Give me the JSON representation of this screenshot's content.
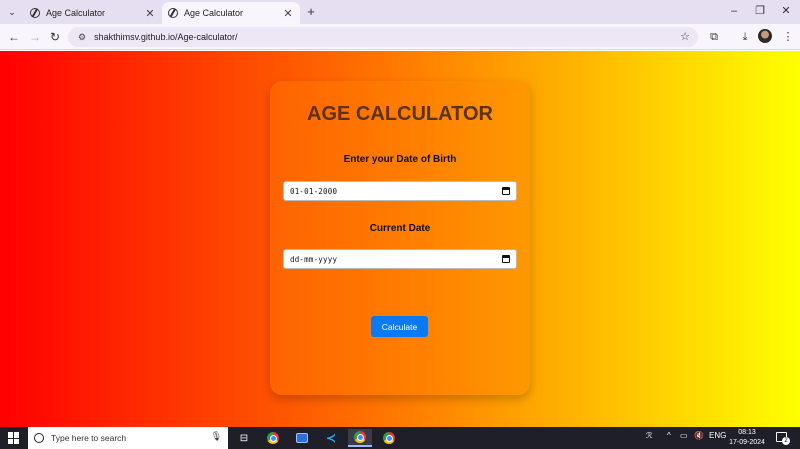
{
  "browser": {
    "tabs": [
      {
        "title": "Age Calculator",
        "active": false
      },
      {
        "title": "Age Calculator",
        "active": true
      }
    ],
    "new_tab": "+",
    "window_controls": {
      "minimize": "–",
      "restore": "❐",
      "close": "✕"
    },
    "url": "shakthimsv.github.io/Age-calculator/"
  },
  "page": {
    "title": "AGE CALCULATOR",
    "dob_label": "Enter your Date of Birth",
    "dob_value": "01-01-2000",
    "current_label": "Current Date",
    "current_value": "dd-mm-yyyy",
    "calculate_label": "Calculate",
    "colors": {
      "gradient_start": "#ff0000",
      "gradient_mid": "#ff7a00",
      "gradient_end": "#ffff00",
      "button": "#0b79f2",
      "title": "#5a3216"
    }
  },
  "taskbar": {
    "search_placeholder": "Type here to search",
    "language": "ENG",
    "time": "08:13",
    "date": "17-09-2024",
    "notification_count": "2"
  }
}
